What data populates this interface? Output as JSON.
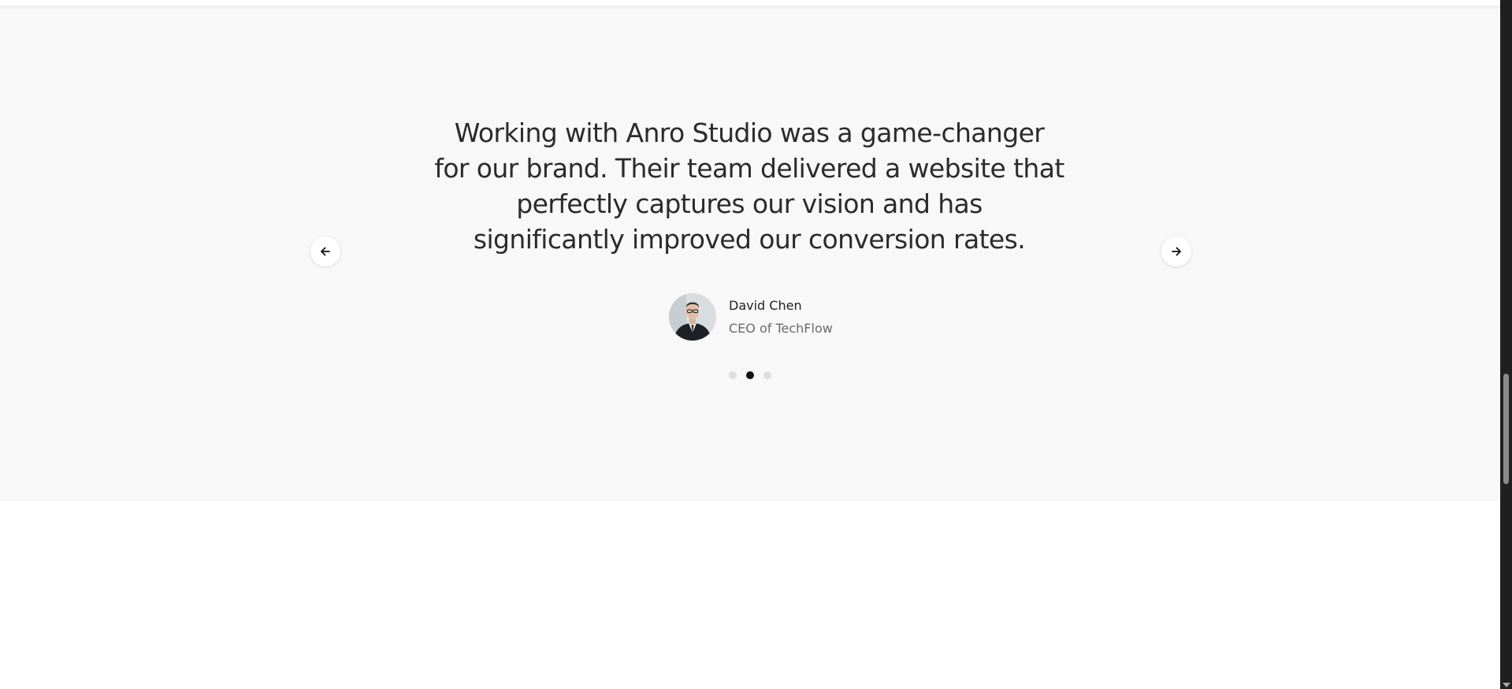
{
  "testimonial": {
    "quote_lines": [
      "Working with Anro Studio was a game-changer",
      "for our brand. Their team delivered a website that",
      "perfectly captures our vision and has",
      "significantly improved our conversion rates."
    ],
    "author_name": "David Chen",
    "author_role": "CEO of TechFlow"
  },
  "carousel": {
    "prev_icon": "arrow-left-icon",
    "next_icon": "arrow-right-icon",
    "slide_count": 3,
    "active_index": 1
  },
  "colors": {
    "section_bg": "#f8f8f8",
    "text": "#2b2b2b",
    "dot_active": "#111111",
    "dot_inactive": "#dedede"
  }
}
